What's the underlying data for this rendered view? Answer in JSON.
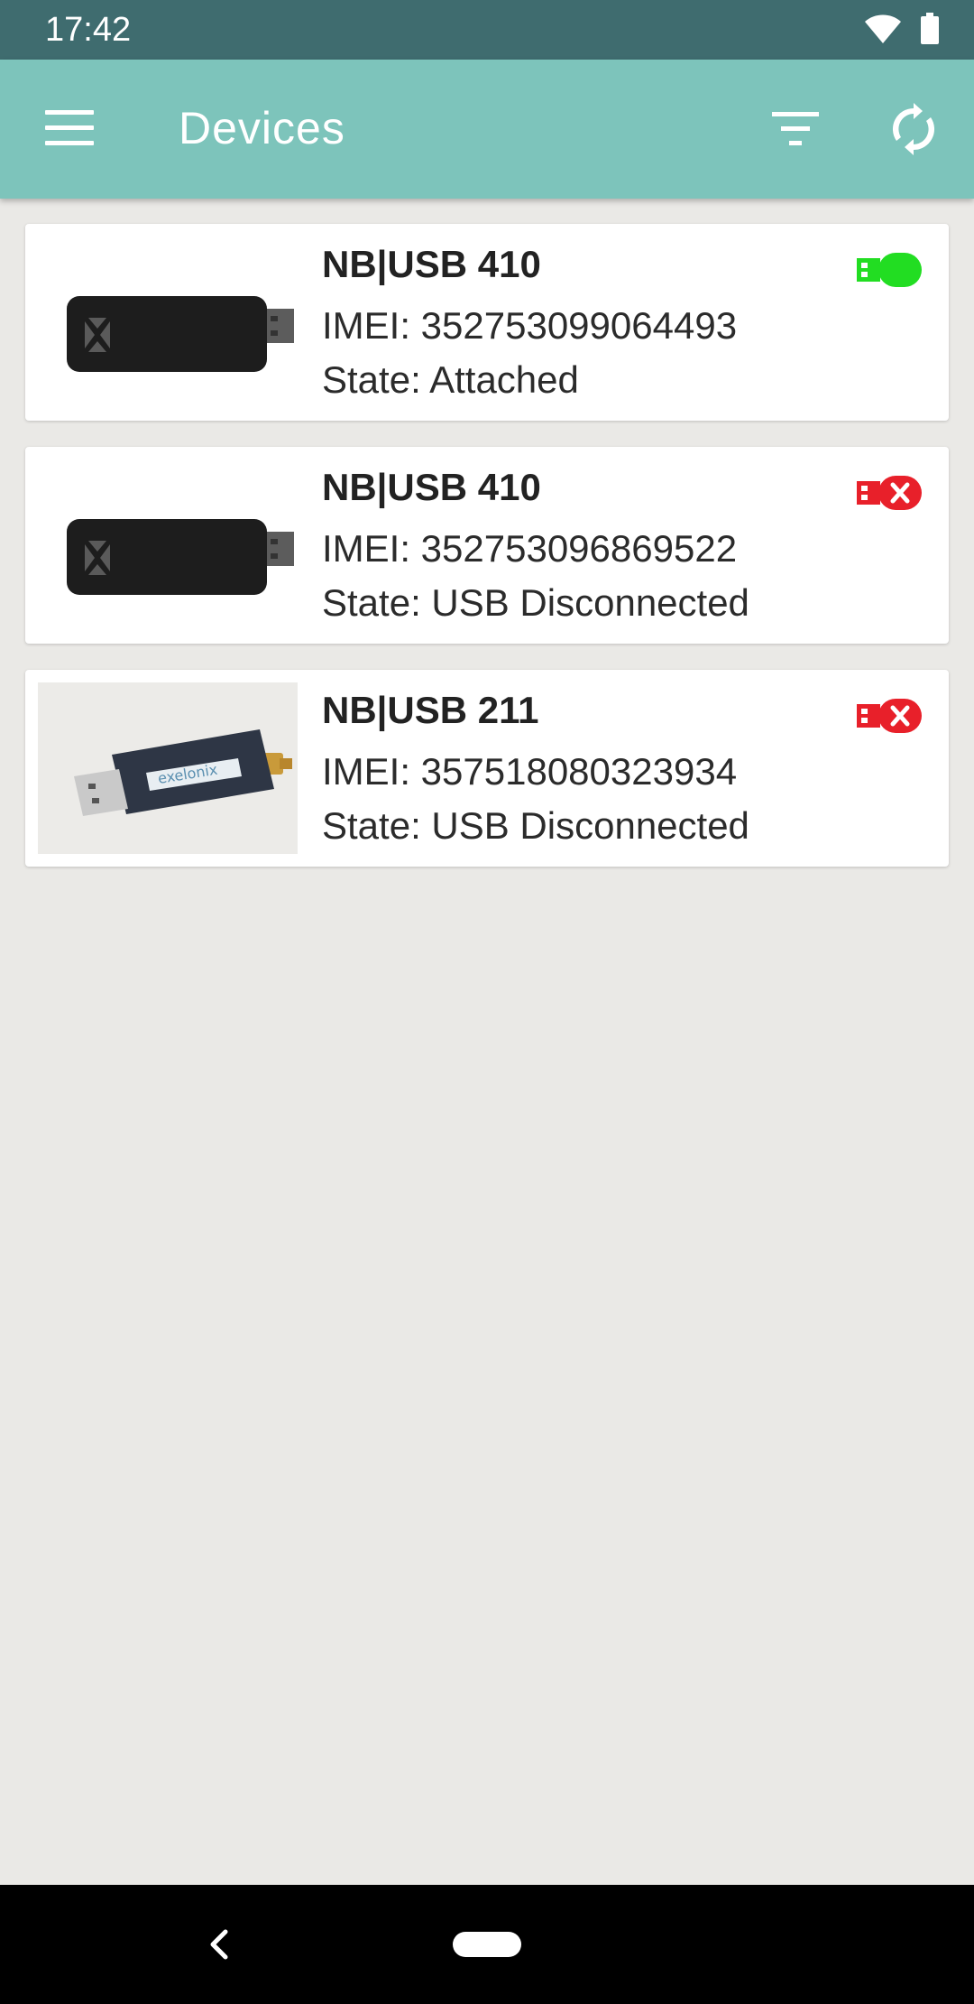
{
  "status_bar": {
    "time": "17:42",
    "icons": [
      "wifi-icon",
      "battery-icon"
    ]
  },
  "app_bar": {
    "title": "Devices",
    "icons": [
      "menu-icon",
      "filter-icon",
      "sync-icon"
    ],
    "color": "#7dc4bb"
  },
  "devices": [
    {
      "name": "NB|USB 410",
      "imei": "IMEI: 352753099064493",
      "state": "State: Attached",
      "status_icon": "usb-connected-icon",
      "status_color": "#22dd22"
    },
    {
      "name": "NB|USB 410",
      "imei": "IMEI: 352753096869522",
      "state": "State: USB Disconnected",
      "status_icon": "usb-disconnected-icon",
      "status_color": "#e8202a"
    },
    {
      "name": "NB|USB 211",
      "imei": "IMEI: 357518080323934",
      "state": "State: USB Disconnected",
      "status_icon": "usb-disconnected-icon",
      "status_color": "#e8202a",
      "image_label": "exelonix"
    }
  ],
  "nav_bar": {
    "icons": [
      "back-icon",
      "home-pill"
    ]
  }
}
